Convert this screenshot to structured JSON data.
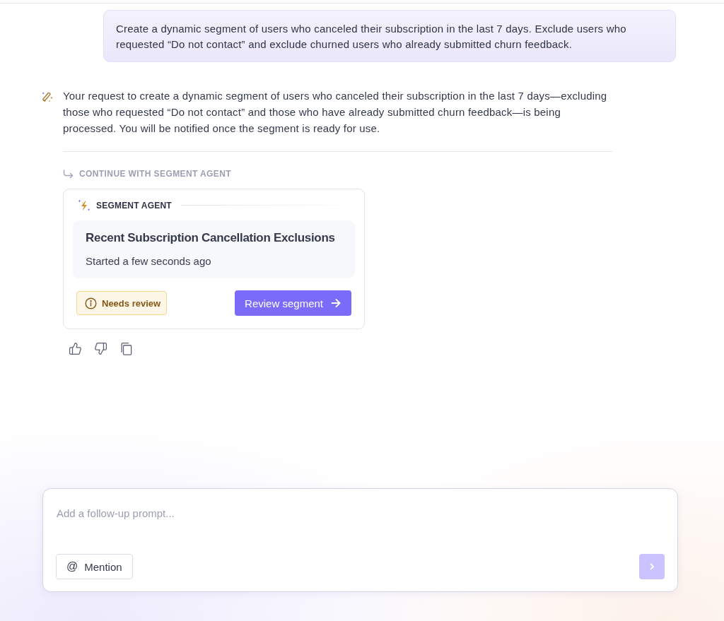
{
  "user_message": {
    "text": "Create a dynamic segment of users who canceled their subscription in the last 7 days. Exclude users who requested “Do not contact” and exclude churned users who already submitted churn feedback."
  },
  "assistant_message": {
    "text": "Your request to create a dynamic segment of users who canceled their subscription in the last 7 days—excluding those who requested “Do not contact” and those who have already submitted churn feedback—is being processed. You will be notified once the segment is ready for use.",
    "continue_label": "CONTINUE WITH SEGMENT AGENT",
    "agent_card": {
      "header": "SEGMENT AGENT",
      "title": "Recent Subscription Cancellation Exclusions",
      "subtitle": "Started a few seconds ago",
      "status_badge": {
        "label": "Needs review",
        "kind": "warning"
      },
      "action_button": {
        "label": "Review segment"
      }
    }
  },
  "composer": {
    "placeholder": "Add a follow-up prompt...",
    "mention_button": {
      "icon": "@",
      "label": "Mention"
    },
    "send_button": {
      "disabled": true
    }
  }
}
